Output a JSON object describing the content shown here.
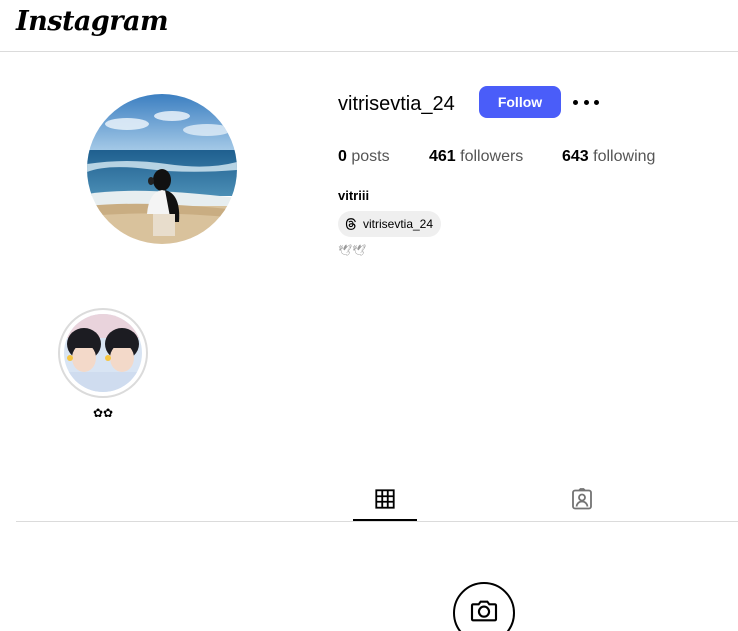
{
  "header": {
    "logo_text": "Instagram"
  },
  "profile": {
    "username": "vitrisevtia_24",
    "follow_label": "Follow",
    "stats": {
      "posts_count": "0",
      "posts_label": "posts",
      "followers_count": "461",
      "followers_label": "followers",
      "following_count": "643",
      "following_label": "following"
    },
    "full_name": "vitriii",
    "threads_handle": "vitrisevtia_24",
    "bio": "🕊🕊"
  },
  "highlights": [
    {
      "label": "✿✿"
    }
  ],
  "tabs": [
    {
      "icon": "grid-icon",
      "active": true
    },
    {
      "icon": "tagged-icon",
      "active": false
    }
  ],
  "colors": {
    "follow_button": "#4a5df9",
    "divider": "#dbdbdb",
    "chip_bg": "#efefef"
  }
}
